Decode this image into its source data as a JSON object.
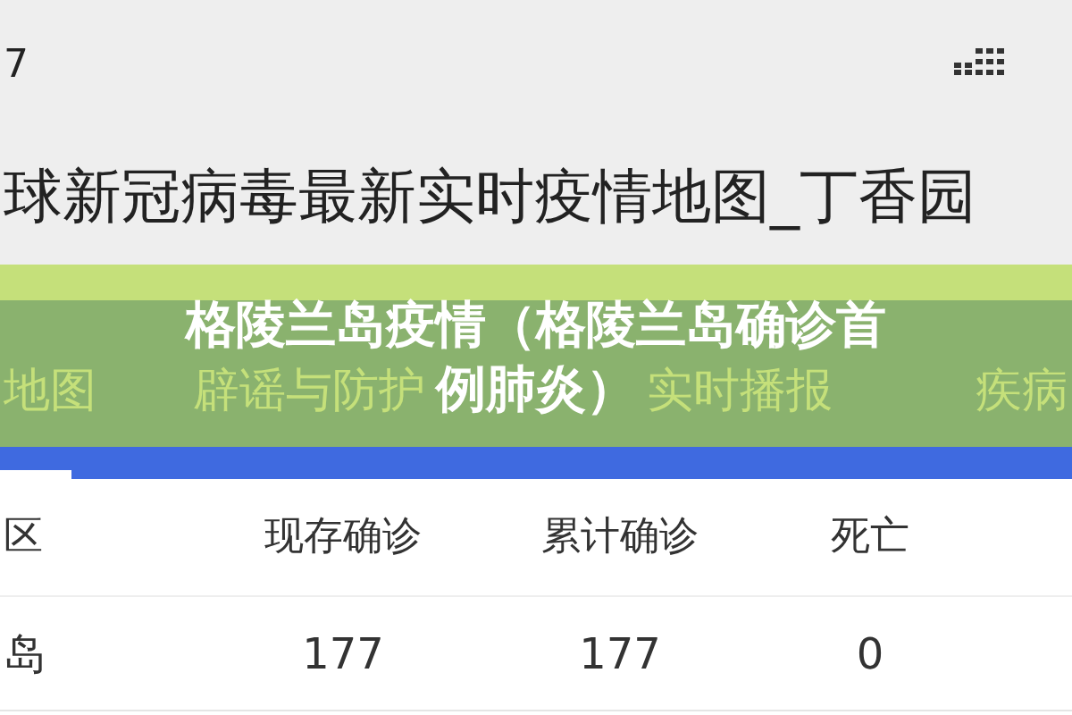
{
  "status_bar": {
    "time": "7"
  },
  "page_title": "球新冠病毒最新实时疫情地图_丁香园",
  "tabs": [
    {
      "label": "地图",
      "selected": false
    },
    {
      "label": "辟谣与防护",
      "selected": false
    },
    {
      "label": "实时播报",
      "selected": false
    },
    {
      "label": "疾病",
      "selected": false
    }
  ],
  "overlay_title": [
    "格陵兰岛疫情（格陵兰岛确诊首",
    "例肺炎）"
  ],
  "sub_tabs": [
    {
      "selected": true
    }
  ],
  "table": {
    "columns": [
      "区",
      "现存确诊",
      "累计确诊",
      "死亡"
    ],
    "rows": [
      [
        "岛",
        "177",
        "177",
        "0"
      ]
    ]
  }
}
